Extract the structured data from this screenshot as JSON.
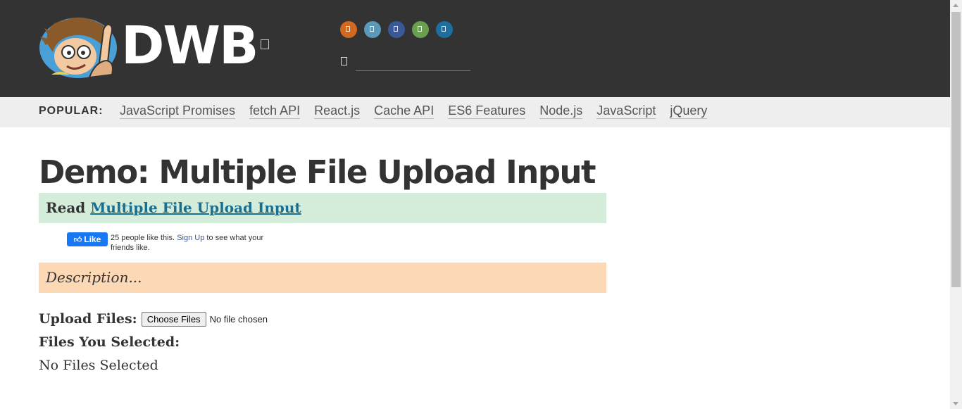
{
  "header": {
    "brand": "DWB",
    "menu_icon": "menu-icon",
    "social": [
      {
        "icon": "rss-icon",
        "color": "#d2691e"
      },
      {
        "icon": "twitter-icon",
        "color": "#5a9ab8"
      },
      {
        "icon": "facebook-icon",
        "color": "#3b5998"
      },
      {
        "icon": "github-icon",
        "color": "#6a9f4f"
      },
      {
        "icon": "linkedin-icon",
        "color": "#1e6ea0"
      }
    ],
    "search": {
      "icon": "search-icon",
      "value": ""
    }
  },
  "popular": {
    "label": "POPULAR:",
    "links": [
      "JavaScript Promises",
      "fetch API",
      "React.js",
      "Cache API",
      "ES6 Features",
      "Node.js",
      "JavaScript",
      "jQuery"
    ]
  },
  "main": {
    "title": "Demo: Multiple File Upload Input",
    "read_prefix": "Read",
    "read_link": "Multiple File Upload Input",
    "fb": {
      "like_label": "Like",
      "count_text": "25 people like this.",
      "signup": "Sign Up",
      "suffix": "to see what your friends like."
    },
    "description": "Description...",
    "upload_label": "Upload Files:",
    "choose_button": "Choose Files",
    "no_file": "No file chosen",
    "selected_heading": "Files You Selected:",
    "no_files": "No Files Selected"
  },
  "colors": {
    "header_bg": "#333333",
    "popular_bg": "#eeeeee",
    "read_bg": "#d4edda",
    "desc_bg": "#fcd8b5",
    "link": "#1a6f8f"
  }
}
